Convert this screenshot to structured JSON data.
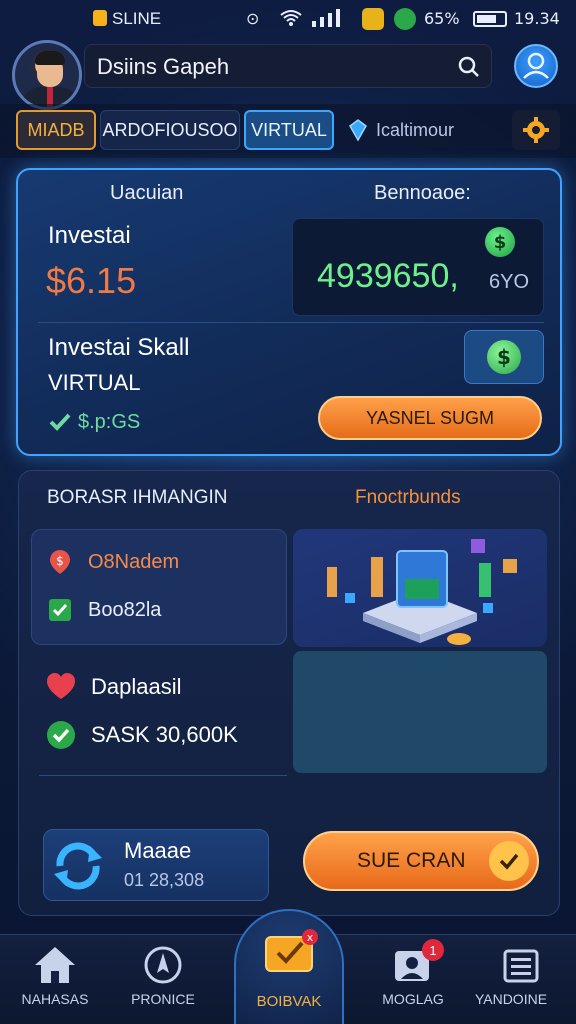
{
  "status_bar": {
    "carrier": "SLINE",
    "battery_percent": "65%",
    "time": "19.34"
  },
  "header": {
    "title": "Dsiins Gapeh"
  },
  "tabs": [
    {
      "label": "MIADB"
    },
    {
      "label": "ARDOFIOUSOO"
    },
    {
      "label": "VIRTUAL"
    },
    {
      "label": "Icaltimour"
    }
  ],
  "invest_card": {
    "header_left": "Uacuian",
    "header_right": "Bennoaoe:",
    "investal_label": "Investai",
    "investal_amount": "$6.15",
    "balance_value": "4939650,",
    "balance_suffix": "6YO",
    "skall_label": "Investai Skall",
    "virtual_label": "VIRTUAL",
    "check_value": "$.p:GS",
    "action_button": "YASNEL SUGM"
  },
  "panel": {
    "header_left": "BORASR IHMANGIN",
    "header_right": "Fnoctrbunds",
    "list": [
      {
        "label": "O8Nadem"
      },
      {
        "label": "Boo82la"
      }
    ],
    "rows": [
      {
        "label": "Daplaasil"
      },
      {
        "label": "SASK 30,600K"
      }
    ],
    "mode_card": {
      "title": "Maaae",
      "value": "01 28,308"
    },
    "cta_button": "SUE CRAN"
  },
  "bottom_nav": [
    {
      "label": "NAHASAS"
    },
    {
      "label": "PRONICE"
    },
    {
      "label": "BOIBVAK",
      "badge": ""
    },
    {
      "label": "MOGLAG",
      "badge": "1"
    },
    {
      "label": "YANDOINE"
    }
  ],
  "colors": {
    "accent_blue": "#3fa3ff",
    "accent_orange": "#f5913c",
    "positive_green": "#6ef08c",
    "background": "#0b1838"
  }
}
